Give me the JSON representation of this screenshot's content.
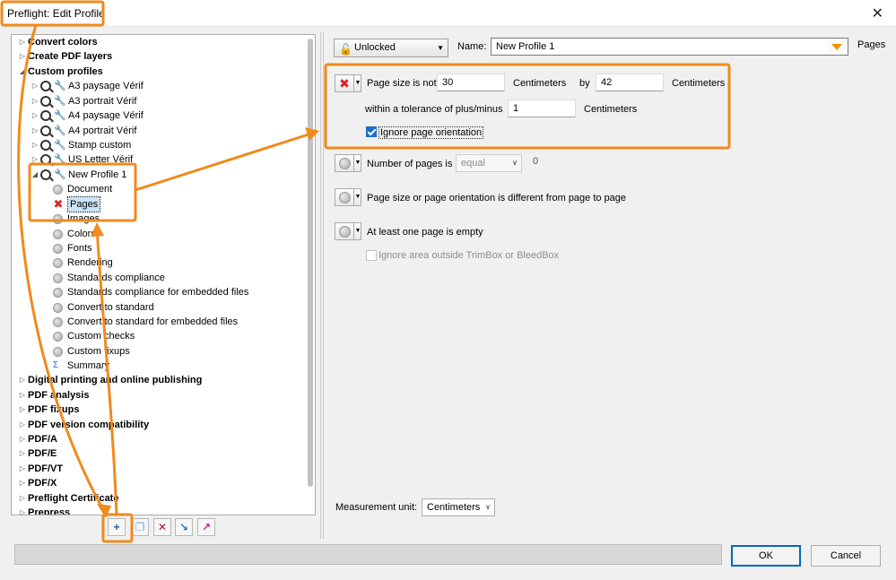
{
  "window": {
    "title": "Preflight: Edit Profile",
    "close_glyph": "✕"
  },
  "tree": {
    "items": [
      {
        "label": "Convert colors",
        "bold": true
      },
      {
        "label": "Create PDF layers",
        "bold": true
      },
      {
        "label": "Custom profiles",
        "bold": true
      },
      {
        "label": "A3 paysage Vérif"
      },
      {
        "label": "A3 portrait Vérif"
      },
      {
        "label": "A4 paysage Vérif"
      },
      {
        "label": "A4 portrait Vérif"
      },
      {
        "label": "Stamp custom"
      },
      {
        "label": "US Letter Vérif"
      },
      {
        "label": "New Profile 1"
      },
      {
        "label": "Document"
      },
      {
        "label": "Pages"
      },
      {
        "label": "Images"
      },
      {
        "label": "Colors"
      },
      {
        "label": "Fonts"
      },
      {
        "label": "Rendering"
      },
      {
        "label": "Standards compliance"
      },
      {
        "label": "Standards compliance for embedded files"
      },
      {
        "label": "Convert to standard"
      },
      {
        "label": "Convert to standard for embedded files"
      },
      {
        "label": "Custom checks"
      },
      {
        "label": "Custom fixups"
      },
      {
        "label": "Summary"
      },
      {
        "label": "Digital printing and online publishing",
        "bold": true
      },
      {
        "label": "PDF analysis",
        "bold": true
      },
      {
        "label": "PDF fixups",
        "bold": true
      },
      {
        "label": "PDF version compatibility",
        "bold": true
      },
      {
        "label": "PDF/A",
        "bold": true
      },
      {
        "label": "PDF/E",
        "bold": true
      },
      {
        "label": "PDF/VT",
        "bold": true
      },
      {
        "label": "PDF/X",
        "bold": true
      },
      {
        "label": "Preflight Certificate",
        "bold": true
      },
      {
        "label": "Prepress",
        "bold": true
      }
    ]
  },
  "toolbar": {
    "icons": [
      "new-profile-icon",
      "duplicate-icon",
      "delete-icon",
      "import-icon",
      "export-icon"
    ]
  },
  "header": {
    "lock_label": "Unlocked",
    "name_label": "Name:",
    "name_value": "New Profile 1",
    "section_label": "Pages"
  },
  "checks": {
    "page_size": {
      "label": "Page size is not",
      "width": "30",
      "unit1": "Centimeters",
      "by": "by",
      "height": "42",
      "unit2": "Centimeters",
      "tolerance_label": "within a tolerance of plus/minus",
      "tolerance": "1",
      "unit3": "Centimeters",
      "ignore_orientation": "Ignore page orientation"
    },
    "num_pages": {
      "label": "Number of pages is",
      "operator": "equal",
      "value": "0"
    },
    "page_size_diff": {
      "label": "Page size or page orientation is different from page to page"
    },
    "empty_page": {
      "label": "At least one page is empty",
      "ignore_label": "Ignore area outside TrimBox or BleedBox"
    }
  },
  "measurement": {
    "label": "Measurement unit:",
    "value": "Centimeters"
  },
  "footer": {
    "ok": "OK",
    "cancel": "Cancel"
  },
  "colors": {
    "accent": "#f08a1c",
    "selection": "#cce4f7",
    "error": "#d22222"
  }
}
